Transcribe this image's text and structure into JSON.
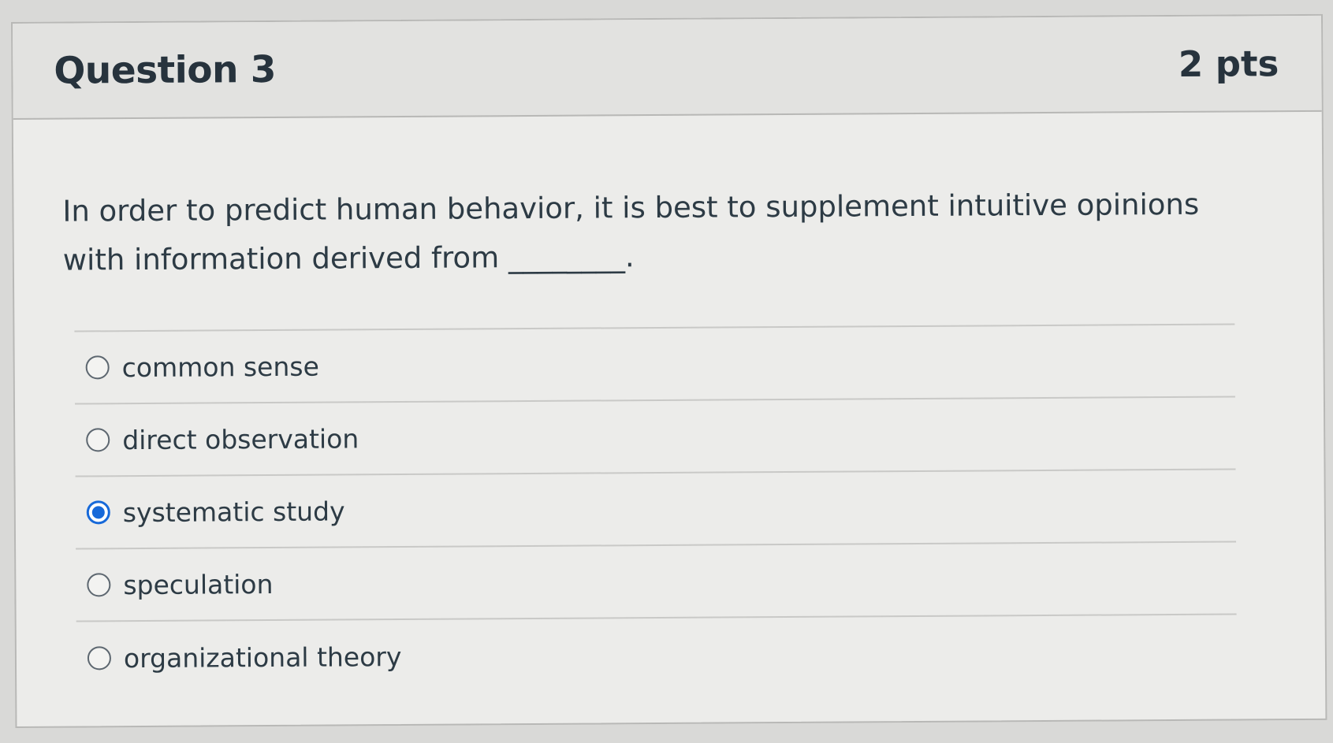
{
  "question": {
    "title": "Question 3",
    "points": "2 pts",
    "text": "In order to predict human behavior, it is best to supplement intuitive opinions with information derived from ________."
  },
  "answers": [
    {
      "label": "common sense",
      "selected": false
    },
    {
      "label": "direct observation",
      "selected": false
    },
    {
      "label": "systematic study",
      "selected": true
    },
    {
      "label": "speculation",
      "selected": false
    },
    {
      "label": "organizational theory",
      "selected": false
    }
  ],
  "colors": {
    "selected_radio": "#1769d9",
    "text": "#2d3b45",
    "background": "#ececea"
  }
}
